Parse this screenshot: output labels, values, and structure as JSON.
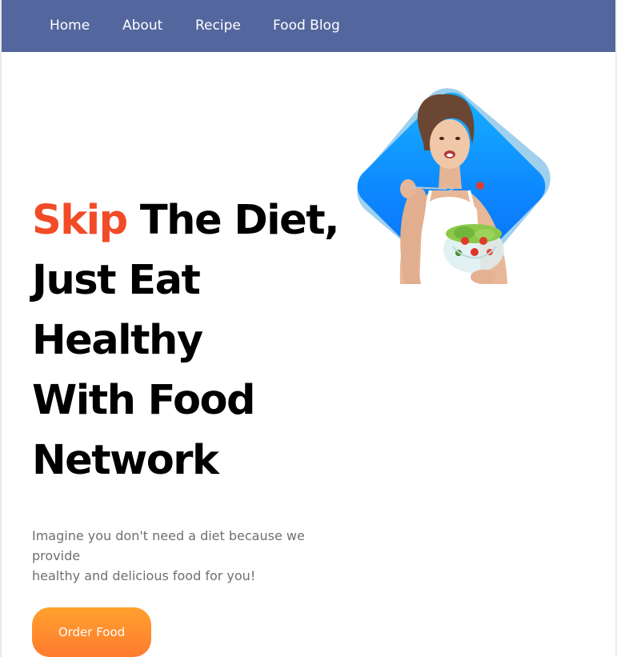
{
  "nav": {
    "items": [
      "Home",
      "About",
      "Recipe",
      "Food Blog"
    ]
  },
  "hero": {
    "title_accent": "Skip",
    "title_line1_rest": " The Diet,",
    "title_line2": "Just Eat",
    "title_line3": "Healthy",
    "title_line4": "With Food",
    "title_line5": "Network",
    "subtitle_line1": "Imagine you don't need a diet because we provide",
    "subtitle_line2": "healthy and delicious food for you!",
    "cta_label": "Order Food",
    "image_subject": "woman-eating-salad"
  },
  "colors": {
    "nav_bg": "#54669e",
    "accent": "#f24b27",
    "button_start": "#ffa12d",
    "button_end": "#ff7a2f",
    "blob_front": "#0d86ff",
    "blob_back": "#9fd0ee"
  }
}
